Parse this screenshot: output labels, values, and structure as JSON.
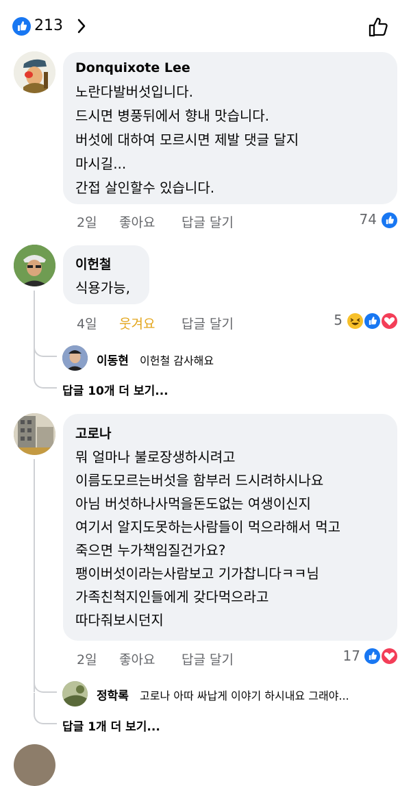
{
  "header": {
    "like_count": "213"
  },
  "comments": [
    {
      "author": "Donquixote Lee",
      "lines": [
        "노란다발버섯입니다.",
        "드시면 병풍뒤에서 향내 맛습니다.",
        "버섯에 대하여 모르시면 제발 댓글 달지",
        "마시길...",
        "간접 살인할수 있습니다."
      ],
      "time": "2일",
      "like_label": "좋아요",
      "reply_label": "답글 달기",
      "reaction_count": "74"
    },
    {
      "author": "이헌철",
      "lines": [
        "식용가능,"
      ],
      "time": "4일",
      "like_label": "웃겨요",
      "reply_label": "답글 달기",
      "reaction_count": "5",
      "reply": {
        "author": "이동현",
        "text": "이헌철 감사해요"
      },
      "more_replies": "답글 10개 더 보기..."
    },
    {
      "author": "고로나",
      "lines": [
        "뭐 얼마나 불로장생하시려고",
        "이름도모르는버섯을 함부러 드시려하시나요",
        "아님 버섯하나사먹을돈도없는 여생이신지",
        "여기서 알지도못하는사람들이 먹으라해서 먹고",
        "죽으면 누가책임질건가요?",
        "팽이버섯이라는사람보고 기가찹니다ㅋㅋ님",
        "가족친척지인들에게 갖다먹으라고",
        "따다줘보시던지"
      ],
      "time": "2일",
      "like_label": "좋아요",
      "reply_label": "답글 달기",
      "reaction_count": "17",
      "reply": {
        "author": "정학록",
        "text": "고로나 아따 싸납게 이야기 하시내요 그래야..."
      },
      "more_replies": "답글 1개 더 보기..."
    }
  ],
  "icons": {
    "like_reaction": "like-icon",
    "haha_reaction": "haha-icon",
    "love_reaction": "love-icon",
    "thumb_outline": "thumbs-up-outline-icon",
    "chevron": "chevron-right-icon"
  },
  "colors": {
    "accent": "#1877f2",
    "bubble": "#f0f2f5",
    "laugh": "#e3a51b",
    "love": "#f33e58",
    "muted": "#65676b"
  }
}
